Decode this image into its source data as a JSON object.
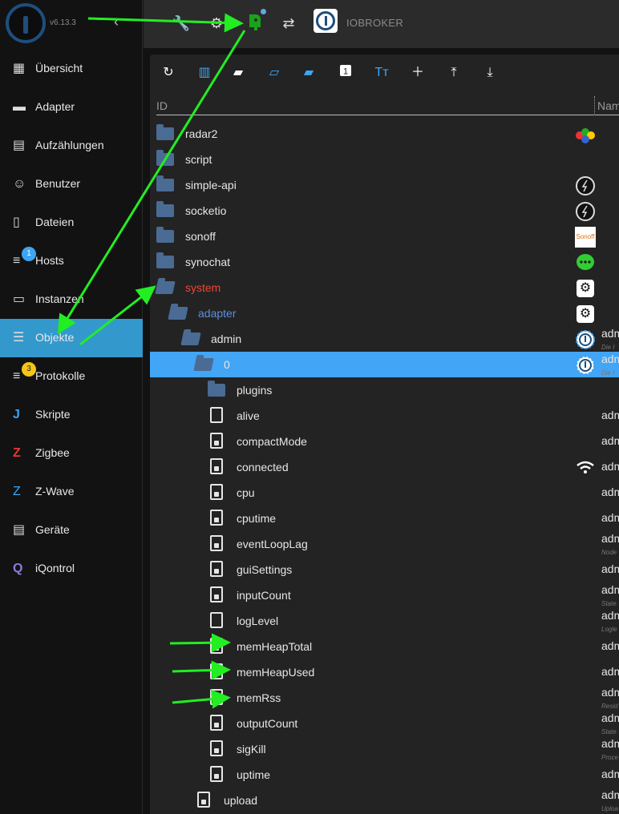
{
  "app": {
    "version": "v6.13.3",
    "title": "IOBROKER",
    "collapse_glyph": "‹"
  },
  "sidebar": {
    "items": [
      {
        "label": "Übersicht",
        "icon": "grid-icon"
      },
      {
        "label": "Adapter",
        "icon": "adapter-icon"
      },
      {
        "label": "Aufzählungen",
        "icon": "list-icon"
      },
      {
        "label": "Benutzer",
        "icon": "user-icon"
      },
      {
        "label": "Dateien",
        "icon": "files-icon"
      },
      {
        "label": "Hosts",
        "icon": "hosts-icon",
        "badge": "1"
      },
      {
        "label": "Instanzen",
        "icon": "instances-icon"
      },
      {
        "label": "Objekte",
        "icon": "objects-icon",
        "active": true
      },
      {
        "label": "Protokolle",
        "icon": "log-icon",
        "badge": "3"
      },
      {
        "label": "Skripte",
        "icon": "js-icon"
      },
      {
        "label": "Zigbee",
        "icon": "zigbee-icon"
      },
      {
        "label": "Z-Wave",
        "icon": "zwave-icon"
      },
      {
        "label": "Geräte",
        "icon": "devices-icon"
      },
      {
        "label": "iQontrol",
        "icon": "iqontrol-icon"
      }
    ]
  },
  "table": {
    "col_id": "ID",
    "col_name": "Nam"
  },
  "tree": [
    {
      "label": "radar2",
      "type": "folder",
      "indent": 0
    },
    {
      "label": "script",
      "type": "folder",
      "indent": 0
    },
    {
      "label": "simple-api",
      "type": "folder",
      "indent": 0
    },
    {
      "label": "socketio",
      "type": "folder",
      "indent": 0
    },
    {
      "label": "sonoff",
      "type": "folder",
      "indent": 0,
      "right_text": "Sonoff"
    },
    {
      "label": "synochat",
      "type": "folder",
      "indent": 0
    },
    {
      "label": "system",
      "type": "folder-open",
      "indent": 0,
      "color": "red"
    },
    {
      "label": "adapter",
      "type": "folder-open",
      "indent": 1,
      "color": "blue"
    },
    {
      "label": "admin",
      "type": "folder-open",
      "indent": 2,
      "name": "adm",
      "sub": "Die I"
    },
    {
      "label": "0",
      "type": "folder-open",
      "indent": 3,
      "selected": true,
      "name": "adm",
      "sub": "Die I"
    },
    {
      "label": "plugins",
      "type": "folder",
      "indent": 4
    },
    {
      "label": "alive",
      "type": "file",
      "indent": 4,
      "name": "adm"
    },
    {
      "label": "compactMode",
      "type": "file-lock",
      "indent": 4,
      "name": "adm"
    },
    {
      "label": "connected",
      "type": "file-lock",
      "indent": 4,
      "name": "adm"
    },
    {
      "label": "cpu",
      "type": "file-lock",
      "indent": 4,
      "name": "adm"
    },
    {
      "label": "cputime",
      "type": "file-lock",
      "indent": 4,
      "name": "adm"
    },
    {
      "label": "eventLoopLag",
      "type": "file-lock",
      "indent": 4,
      "name": "adm",
      "sub": "Node"
    },
    {
      "label": "guiSettings",
      "type": "file-lock",
      "indent": 4,
      "name": "adm"
    },
    {
      "label": "inputCount",
      "type": "file-lock",
      "indent": 4,
      "name": "adm",
      "sub": "State"
    },
    {
      "label": "logLevel",
      "type": "file",
      "indent": 4,
      "name": "adm",
      "sub": "Logle"
    },
    {
      "label": "memHeapTotal",
      "type": "file-lock",
      "indent": 4,
      "name": "adm"
    },
    {
      "label": "memHeapUsed",
      "type": "file-lock",
      "indent": 4,
      "name": "adm"
    },
    {
      "label": "memRss",
      "type": "file-lock",
      "indent": 4,
      "name": "adm",
      "sub": "Resid"
    },
    {
      "label": "outputCount",
      "type": "file-lock",
      "indent": 4,
      "name": "adm",
      "sub": "State"
    },
    {
      "label": "sigKill",
      "type": "file-lock",
      "indent": 4,
      "name": "adm",
      "sub": "Proce"
    },
    {
      "label": "uptime",
      "type": "file-lock",
      "indent": 4,
      "name": "adm"
    },
    {
      "label": "upload",
      "type": "file-lock",
      "indent": 3,
      "name": "adm",
      "sub": "Uploa"
    }
  ],
  "colors": {
    "accent": "#3399cc",
    "selected_row": "#42a5f5",
    "annotation_arrow": "#22ee22"
  }
}
